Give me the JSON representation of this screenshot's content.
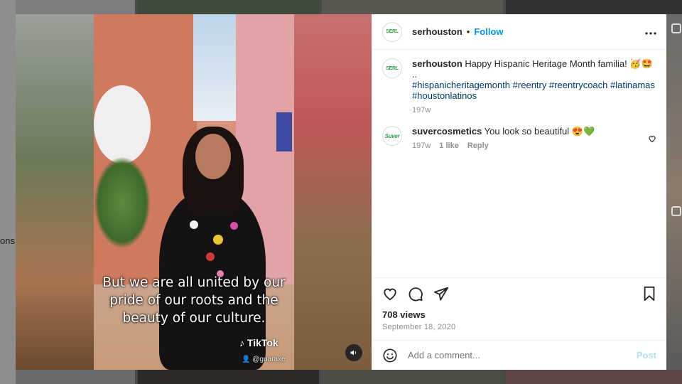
{
  "background": {
    "left_text": "ons"
  },
  "post": {
    "username": "serhouston",
    "follow_label": "Follow",
    "header_separator": "•",
    "avatar_text": "SERL",
    "caption": {
      "text": "Happy Hispanic Heritage Month familia! 🥳🤩",
      "dots": "..",
      "hashtags": [
        "#hispanicheritagemonth",
        "#reentry",
        "#reentrycoach",
        "#latinamas",
        "#houstonlatinos"
      ],
      "time": "197w"
    },
    "comments": [
      {
        "username": "suvercosmetics",
        "avatar_text": "Suver",
        "text": "You look so beautiful 😍💚",
        "time": "197w",
        "likes": "1 like",
        "reply_label": "Reply"
      }
    ],
    "views": "708 views",
    "date": "September 18, 2020",
    "add_comment_placeholder": "Add a comment...",
    "post_button": "Post"
  },
  "video": {
    "caption_lines": [
      "But we are all united by our",
      "pride of our roots and the",
      "beauty of our culture."
    ],
    "watermark": "TikTok",
    "handle": "@guaraxe"
  },
  "colors": {
    "link": "#0095f6",
    "hashtag": "#00376b",
    "muted": "#8e8e8e",
    "post_disabled": "#b2dffc"
  },
  "icons": [
    "more-icon",
    "heart-icon",
    "comment-icon",
    "share-icon",
    "bookmark-icon",
    "emoji-icon",
    "sound-icon"
  ]
}
